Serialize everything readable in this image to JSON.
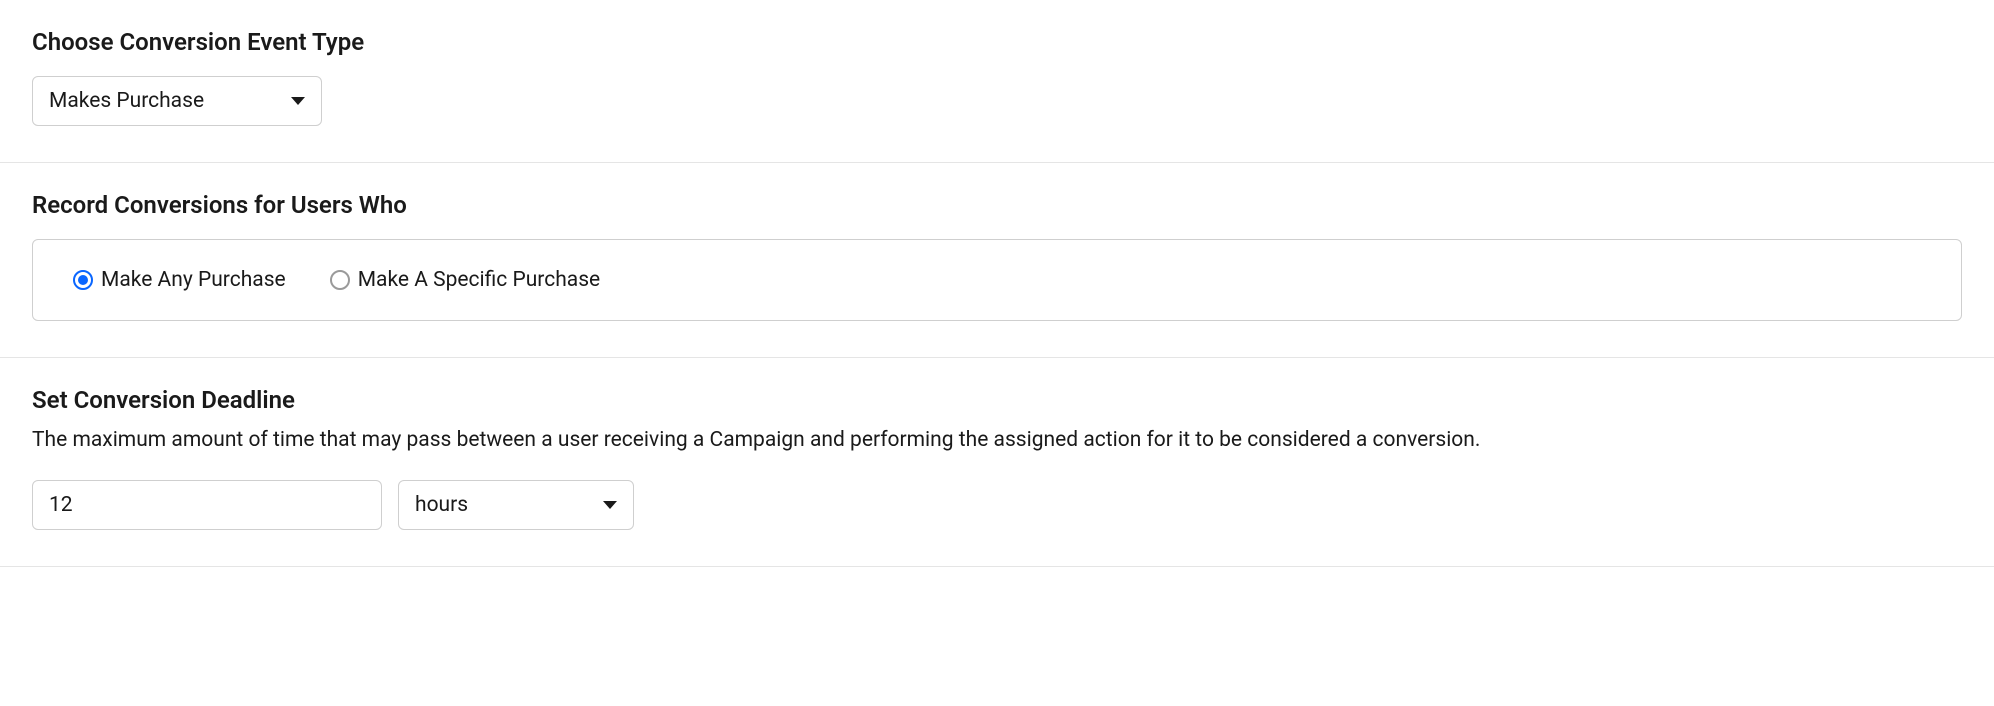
{
  "event_type": {
    "title": "Choose Conversion Event Type",
    "selected": "Makes Purchase"
  },
  "record": {
    "title": "Record Conversions for Users Who",
    "options": [
      {
        "label": "Make Any Purchase",
        "checked": true
      },
      {
        "label": "Make A Specific Purchase",
        "checked": false
      }
    ]
  },
  "deadline": {
    "title": "Set Conversion Deadline",
    "description": "The maximum amount of time that may pass between a user receiving a Campaign and performing the assigned action for it to be considered a conversion.",
    "value": "12",
    "unit": "hours"
  }
}
